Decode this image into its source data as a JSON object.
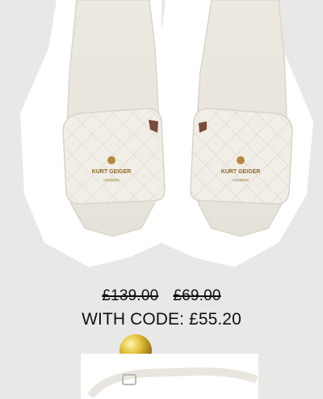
{
  "product": {
    "brand_logo_text": "KURT GEIGER",
    "brand_logo_subtext": "LONDON",
    "image_alt": "sandals-product-image"
  },
  "pricing": {
    "original_price": "£139.00",
    "sale_price": "£69.00",
    "code_offer": "WITH CODE: £55.20"
  },
  "colors": {
    "background": "#e8e8e6",
    "sandal": "#efece4",
    "outline": "#ffffff",
    "text": "#111111",
    "gold": "#d9b323"
  }
}
